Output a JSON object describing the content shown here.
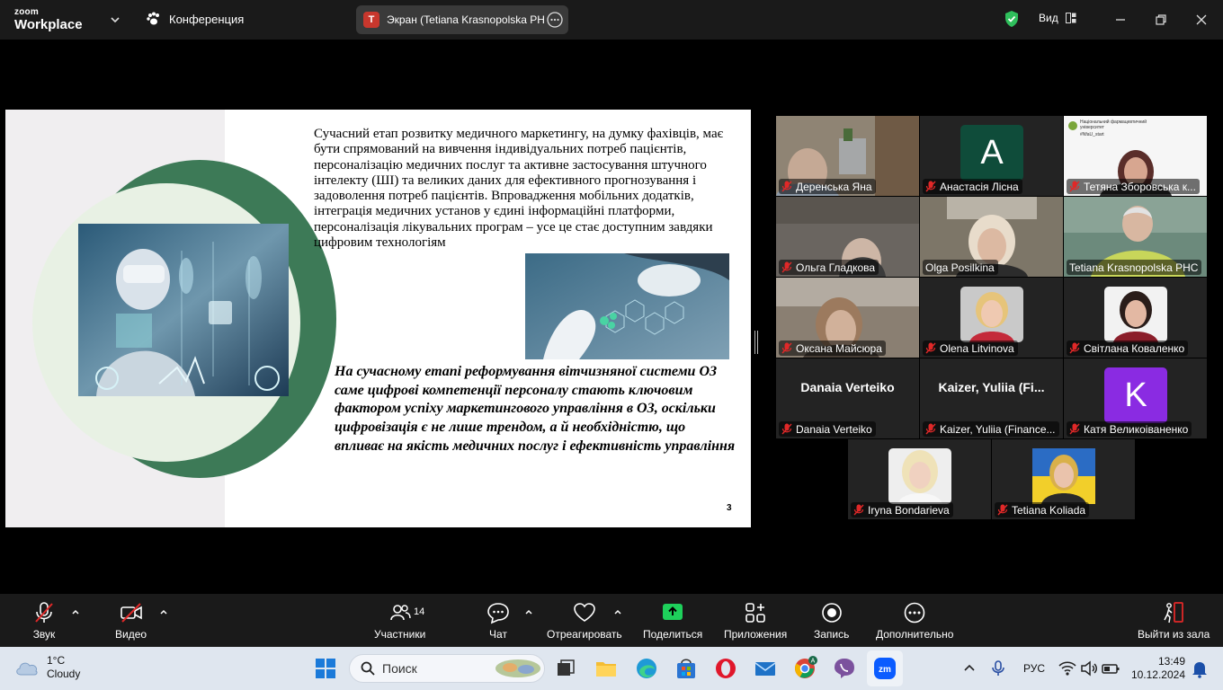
{
  "topbar": {
    "logo_line1": "zoom",
    "logo_line2": "Workplace",
    "conference_label": "Конференция",
    "screen_share_label": "Экран (Tetiana Krasnopolska PHC",
    "screen_share_initial": "T",
    "view_label": "Вид"
  },
  "slide": {
    "paragraph": "Сучасний етап розвитку медичного маркетингу, на думку фахівців, має бути спрямований на вивчення індивідуальних потреб пацієнтів, персоналізацію медичних послуг та активне застосування штучного інтелекту (ШІ) та великих даних для ефективного прогнозування і задоволення потреб пацієнтів. Впровадження мобільних додатків, інтеграція медичних установ у єдині інформаційні платформи, персоналізація лікувальних програм – усе це стає доступним завдяки цифровим технологіям",
    "bold_text": "На сучасному етапі реформування вітчизняної системи ОЗ саме цифрові компетенції персоналу стають ключовим фактором успіху маркетингового управління в ОЗ, оскільки цифровізація є не лише трендом, а й необхідністю, що впливає на якість медичних послуг і ефективність управління",
    "page_number": "3"
  },
  "participants": [
    {
      "name": "Деренська Яна",
      "type": "video",
      "bg": "#8f8474"
    },
    {
      "name": "Анастасія Лісна",
      "type": "avatar",
      "initial": "A",
      "avatar_color": "#0f4c3a"
    },
    {
      "name": "Тетяна Зборовська к...",
      "type": "video",
      "bg": "#f2f2f2",
      "banner_line1": "Національний фармацевтичний",
      "banner_line2": "університет",
      "banner_tag": "#NfaU_start"
    },
    {
      "name": "Ольга Гладкова",
      "type": "video",
      "bg": "#6a6560"
    },
    {
      "name": "Olga Posilkina",
      "type": "video",
      "bg": "#7d7668"
    },
    {
      "name": "Tetiana Krasnopolska PHC",
      "type": "video",
      "bg": "#6c8a7c",
      "active": true
    },
    {
      "name": "Оксана Майсюра",
      "type": "video",
      "bg": "#8a7f72"
    },
    {
      "name": "Olena Litvinova",
      "type": "photo",
      "bg": "#232323"
    },
    {
      "name": "Світлана Коваленко",
      "type": "photo",
      "bg": "#232323"
    },
    {
      "name": "Danaia Verteiko",
      "type": "text",
      "display_name": "Danaia Verteiko"
    },
    {
      "name": "Kaizer, Yuliia (Finance...",
      "type": "text",
      "display_name": "Kaizer,  Yuliia  (Fi..."
    },
    {
      "name": "Катя Великоіваненко",
      "type": "avatar",
      "initial": "K",
      "avatar_color": "#8a2be2"
    },
    {
      "name": "Iryna Bondarieva",
      "type": "photo",
      "bg": "#232323"
    },
    {
      "name": "Tetiana Koliada",
      "type": "photo",
      "bg": "#232323"
    }
  ],
  "toolbar": {
    "audio_label": "Звук",
    "video_label": "Видео",
    "participants_label": "Участники",
    "participants_count": "14",
    "chat_label": "Чат",
    "react_label": "Отреагировать",
    "share_label": "Поделиться",
    "apps_label": "Приложения",
    "record_label": "Запись",
    "more_label": "Дополнительно",
    "leave_label": "Выйти из зала"
  },
  "taskbar": {
    "temperature": "1°C",
    "weather": "Cloudy",
    "search_placeholder": "Поиск",
    "language": "РУС",
    "time": "13:49",
    "date": "10.12.2024"
  }
}
